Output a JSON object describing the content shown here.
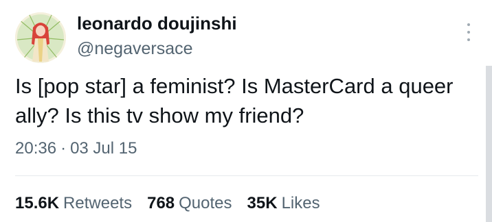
{
  "author": {
    "display_name": "leonardo doujinshi",
    "handle": "@negaversace"
  },
  "tweet": {
    "text": "Is [pop star] a feminist? Is MasterCard a queer ally? Is this tv show my friend?",
    "time": "20:36",
    "separator": "·",
    "date": "03 Jul 15"
  },
  "stats": [
    {
      "count": "15.6K",
      "label": "Retweets"
    },
    {
      "count": "768",
      "label": "Quotes"
    },
    {
      "count": "35K",
      "label": "Likes"
    }
  ],
  "icons": {
    "more": "more-vertical-icon",
    "avatar": "avatar-illustration"
  },
  "colors": {
    "text_primary": "#0f1419",
    "text_secondary": "#536471",
    "divider": "#e6e9ec"
  }
}
